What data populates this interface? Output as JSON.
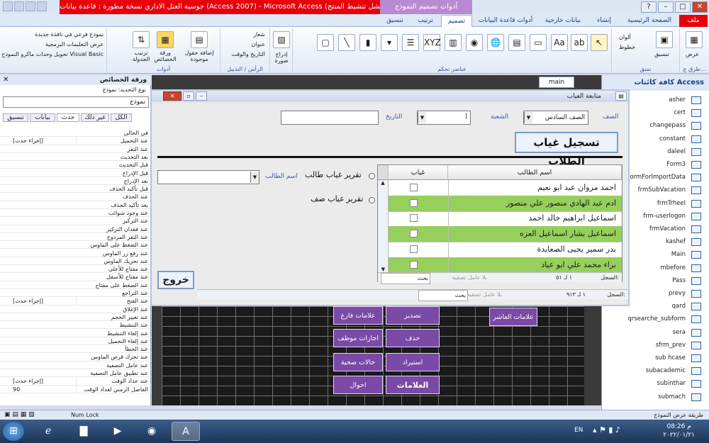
{
  "window": {
    "title": "جوسية العتل الاداري نسخة مطورة : قاعدة بيانات (Access 2007) - Microsoft Access (فشل تنشيط المنتج)",
    "context_tab": "أدوات تصميم النموذج"
  },
  "ribbon_tabs": [
    "ملف",
    "الصفحة الرئيسية",
    "إنشاء",
    "بيانات خارجية",
    "أدوات قاعدة البيانات",
    "تصميم",
    "ترتيب",
    "تنسيق"
  ],
  "ribbon": {
    "views_label": "طرق ع...",
    "view_btn": "عرض",
    "format_btn": "تنسيق",
    "themes_label": "نسق",
    "colors": "ألوان",
    "fonts": "خطوط",
    "controls_label": "عناصر تحكم",
    "insert_image": "إدراج صورة",
    "header_footer_label": "الرأس / التذييل",
    "logo": "شعار",
    "title": "عنوان",
    "date_time": "التاريخ والوقت",
    "add_fields": "إضافة حقول موجودة",
    "property_sheet": "ورقة الخصائص",
    "tab_order": "ترتيب الجدولة",
    "subform_new": "نموذج فرعي في نافذة جديدة",
    "view_code": "عرض التعليمات البرمجية",
    "convert_macros": "تحويل وحدات ماكرو النموذج إلى Visual Basic",
    "tools_label": "أدوات"
  },
  "property_sheet": {
    "title": "ورقة الخصائص",
    "selection_label": "نوع التحديد: نموذج",
    "selection_value": "نموذج",
    "tabs": [
      "تنسيق",
      "بيانات",
      "حدث",
      "غير ذلك",
      "الكل"
    ],
    "rows": [
      {
        "label": "في الحالي",
        "value": ""
      },
      {
        "label": "عند التحميل",
        "value": "[إجراء حدث]"
      },
      {
        "label": "عند النقر",
        "value": ""
      },
      {
        "label": "بعد التحديث",
        "value": ""
      },
      {
        "label": "قبل التحديث",
        "value": ""
      },
      {
        "label": "قبل الإدراج",
        "value": ""
      },
      {
        "label": "بعد الإدراج",
        "value": ""
      },
      {
        "label": "قبل تأكيد الحذف",
        "value": ""
      },
      {
        "label": "عند الحذف",
        "value": ""
      },
      {
        "label": "بعد تأكيد الحذف",
        "value": ""
      },
      {
        "label": "عند وجود شوائب",
        "value": ""
      },
      {
        "label": "عند التركيز",
        "value": ""
      },
      {
        "label": "عند فقدان التركيز",
        "value": ""
      },
      {
        "label": "عند النقر المزدوج",
        "value": ""
      },
      {
        "label": "عند الضغط على الماوس",
        "value": ""
      },
      {
        "label": "عند رفع زر الماوس",
        "value": ""
      },
      {
        "label": "عند تحريك الماوس",
        "value": ""
      },
      {
        "label": "عند مفتاح للأعلى",
        "value": ""
      },
      {
        "label": "عند مفتاح للأسفل",
        "value": ""
      },
      {
        "label": "عند الضغط على مفتاح",
        "value": ""
      },
      {
        "label": "عند التراجع",
        "value": ""
      },
      {
        "label": "عند الفتح",
        "value": "[إجراء حدث]"
      },
      {
        "label": "عند الإغلاق",
        "value": ""
      },
      {
        "label": "عند تغيير الحجم",
        "value": ""
      },
      {
        "label": "عند التنشيط",
        "value": ""
      },
      {
        "label": "عند إلغاء التنشيط",
        "value": ""
      },
      {
        "label": "عند إلغاء التحميل",
        "value": ""
      },
      {
        "label": "عند الخطأ",
        "value": ""
      },
      {
        "label": "عند تحرك قرص الماوس",
        "value": ""
      },
      {
        "label": "عند عامل التصفية",
        "value": ""
      },
      {
        "label": "عند تطبيق عامل التصفية",
        "value": ""
      },
      {
        "label": "عند عداد الوقت",
        "value": "[إجراء حدث]"
      },
      {
        "label": "الفاصل الزمني لعداد الوقت",
        "value": "90"
      }
    ]
  },
  "nav_pane": {
    "title": "كافة كائنات Access",
    "items": [
      "asher",
      "cert",
      "changepass",
      "constant",
      "daleel",
      "Form3",
      "FormForImportData",
      "frmSubVacation",
      "frmTrheel",
      "frm-userlogon",
      "frmVacation",
      "kashef",
      "Main",
      "mbefore",
      "Pass",
      "prevy",
      "qard",
      "qrsearche_subform",
      "sera",
      "sfrm_prev",
      "sub hcase",
      "subacademic",
      "subinthar",
      "submach"
    ]
  },
  "workspace": {
    "main_tab": "main",
    "buttons": [
      {
        "label": "علامات العاشر"
      },
      {
        "label": "تصدير"
      },
      {
        "label": "علامات فارغ"
      },
      {
        "label": "حذف"
      },
      {
        "label": "اجازات موظف"
      },
      {
        "label": "استيراد"
      },
      {
        "label": "حالات صحية"
      },
      {
        "label": "العلامات"
      },
      {
        "label": "احوال"
      }
    ]
  },
  "dialog": {
    "title": "متابعة الغياب",
    "class_label": "الصف",
    "class_value": "الصف السادس",
    "section_label": "الشعبة",
    "section_value": "أ",
    "date_label": "التاريخ",
    "date_value": "",
    "heading": "تسجيل غياب الطلاب",
    "table": {
      "col_name": "اسم الطالب",
      "col_absence": "غياب",
      "rows": [
        {
          "name": "احمد مروان عيد ابو نعيم",
          "absent": false
        },
        {
          "name": "ادم عبد الهادي منصور علي منصور",
          "absent": false
        },
        {
          "name": "اسماعيل ابراهيم خالد احمد",
          "absent": false
        },
        {
          "name": "اسماعيل بشار اسماعيل العزه",
          "absent": false
        },
        {
          "name": "بدر سمير يحيى الصعايدة",
          "absent": false
        },
        {
          "name": "براء محمد علي ابو عياد",
          "absent": false
        }
      ],
      "record_label": "السجل:",
      "record_pos": "١ لـ ٥١",
      "no_filter": "بلا عامل تصفية",
      "search": "بحث"
    },
    "report_student": "تقرير غياب طالب",
    "report_class": "تقرير غياب صف",
    "student_name_label": "اسم الطالب",
    "exit": "خروج",
    "outer_record_label": "السجل:",
    "outer_record_pos": "١ لـ ٩١٣",
    "outer_no_filter": "بلا عامل تصفية",
    "outer_search": "بحث"
  },
  "status": {
    "left": "طريقة عرض النموذج",
    "num_lock": "Num Lock"
  },
  "taskbar": {
    "lang": "EN",
    "time": "08:26 م",
    "date": "٢٠٢٢/٠١/٢١"
  }
}
